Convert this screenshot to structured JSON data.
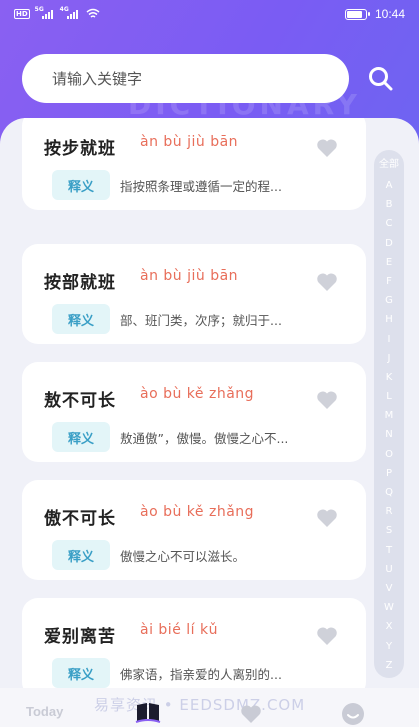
{
  "status_bar": {
    "net_badge": "HD",
    "signal1_tag": "5G",
    "signal2_tag": "4G",
    "battery_level": 0.85,
    "time": "10:44"
  },
  "header": {
    "watermark_word": "DICTIONARY",
    "search": {
      "placeholder": "请输入关键字",
      "icon": "search-icon"
    }
  },
  "entries": [
    {
      "word": "按步就班",
      "pinyin": "àn bù jiù bān",
      "badge": "释义",
      "definition": "指按照条理或遵循一定的程...",
      "favorited": false
    },
    {
      "word": "按部就班",
      "pinyin": "àn bù jiù bān",
      "badge": "释义",
      "definition": "部、班门类，次序；就归于...",
      "favorited": false
    },
    {
      "word": "敖不可长",
      "pinyin": "ào bù kě zhǎng",
      "badge": "释义",
      "definition": "敖通傲”，傲慢。傲慢之心不...",
      "favorited": false
    },
    {
      "word": "傲不可长",
      "pinyin": "ào bù kě zhǎng",
      "badge": "释义",
      "definition": "傲慢之心不可以滋长。",
      "favorited": false
    },
    {
      "word": "爱别离苦",
      "pinyin": "ài bié lí kǔ",
      "badge": "释义",
      "definition": "佛家语，指亲爱的人离别的...",
      "favorited": false
    }
  ],
  "alphabet_index": {
    "all_label": "全部",
    "letters": [
      "A",
      "B",
      "C",
      "D",
      "E",
      "F",
      "G",
      "H",
      "I",
      "J",
      "K",
      "L",
      "M",
      "N",
      "O",
      "P",
      "Q",
      "R",
      "S",
      "T",
      "U",
      "V",
      "W",
      "X",
      "Y",
      "Z"
    ]
  },
  "tabbar": {
    "today_label": "Today",
    "watermark": "易享资讯 • EEDSDMZ.COM",
    "tabs": [
      "today",
      "book-icon",
      "heart-icon",
      "smile-icon"
    ]
  },
  "colors": {
    "header_gradient_start": "#8a60f2",
    "header_gradient_end": "#6d65f2",
    "pinyin": "#e86e5a",
    "badge_bg": "#e3f5f8",
    "badge_text": "#3a9fc6",
    "heart": "#cfd1d9"
  }
}
